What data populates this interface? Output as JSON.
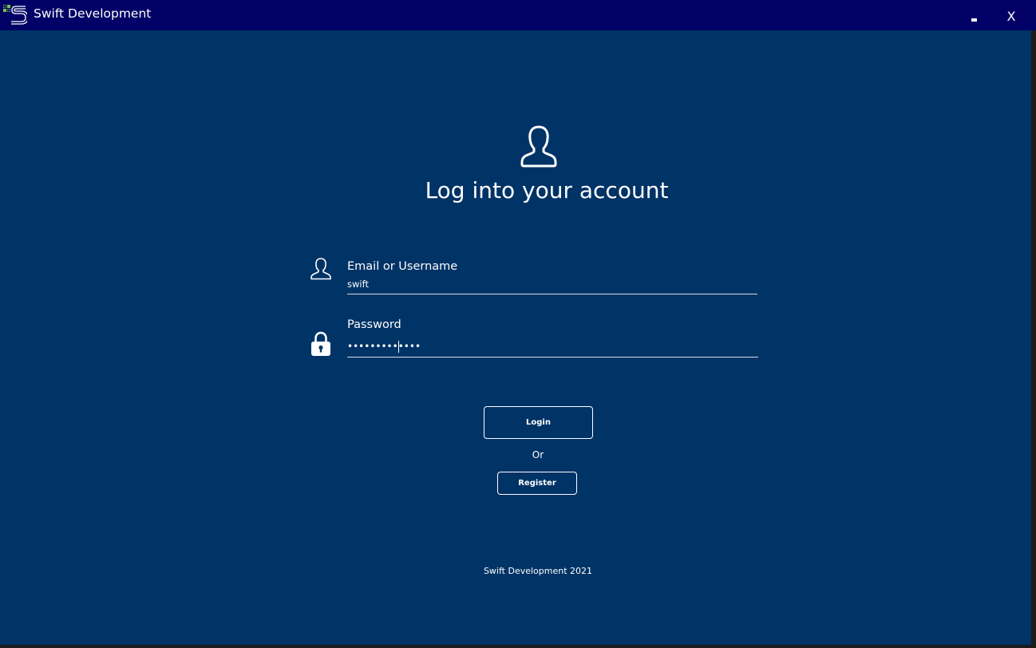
{
  "window": {
    "title": "Swift Development",
    "minimize_icon": "minimize-icon",
    "close_label": "X"
  },
  "login": {
    "account_icon": "account-icon",
    "title": "Log into your account",
    "email_label": "Email or Username",
    "email_value": "swift",
    "email_icon": "user-icon",
    "password_label": "Password",
    "password_value": "•••••••••••••",
    "password_icon": "lock-icon",
    "login_button": "Login",
    "or_text": "Or",
    "register_button": "Register"
  },
  "footer": {
    "text": "Swift Development 2021"
  },
  "colors": {
    "background": "#003366",
    "titlebar": "#000066",
    "text": "#ffffff",
    "logo_accent": "#7fc241"
  }
}
